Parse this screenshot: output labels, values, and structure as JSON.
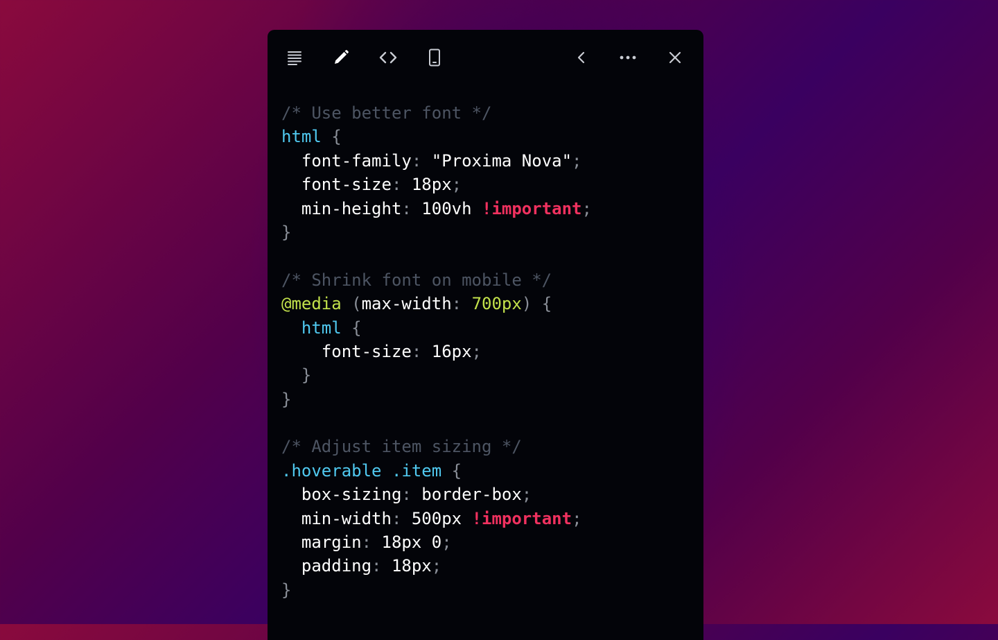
{
  "toolbar": {
    "left_icons": [
      "text-align-icon",
      "pencil-icon",
      "code-icon",
      "mobile-device-icon"
    ],
    "right_icons": [
      "chevron-left-icon",
      "more-horizontal-icon",
      "close-icon"
    ]
  },
  "colors": {
    "panel_bg": "#030409",
    "comment": "#4d5563",
    "selector": "#50c9f0",
    "at_rule": "#c2e14b",
    "important": "#f0315f",
    "punctuation": "#8a8f98",
    "text": "#ffffff"
  },
  "code": {
    "lines": [
      [
        {
          "t": "comment",
          "v": "/* Use better font */"
        }
      ],
      [
        {
          "t": "sel",
          "v": "html"
        },
        {
          "t": "punct",
          "v": " {"
        }
      ],
      [
        {
          "t": "prop",
          "v": "  font-family"
        },
        {
          "t": "punct",
          "v": ": "
        },
        {
          "t": "val",
          "v": "\"Proxima Nova\""
        },
        {
          "t": "punct",
          "v": ";"
        }
      ],
      [
        {
          "t": "prop",
          "v": "  font-size"
        },
        {
          "t": "punct",
          "v": ": "
        },
        {
          "t": "val",
          "v": "18px"
        },
        {
          "t": "punct",
          "v": ";"
        }
      ],
      [
        {
          "t": "prop",
          "v": "  min-height"
        },
        {
          "t": "punct",
          "v": ": "
        },
        {
          "t": "val",
          "v": "100vh "
        },
        {
          "t": "imp",
          "v": "!important"
        },
        {
          "t": "punct",
          "v": ";"
        }
      ],
      [
        {
          "t": "punct",
          "v": "}"
        }
      ],
      [],
      [
        {
          "t": "comment",
          "v": "/* Shrink font on mobile */"
        }
      ],
      [
        {
          "t": "at",
          "v": "@media"
        },
        {
          "t": "punct",
          "v": " ("
        },
        {
          "t": "prop",
          "v": "max-width"
        },
        {
          "t": "punct",
          "v": ": "
        },
        {
          "t": "num",
          "v": "700px"
        },
        {
          "t": "punct",
          "v": ") {"
        }
      ],
      [
        {
          "t": "sel",
          "v": "  html"
        },
        {
          "t": "punct",
          "v": " {"
        }
      ],
      [
        {
          "t": "prop",
          "v": "    font-size"
        },
        {
          "t": "punct",
          "v": ": "
        },
        {
          "t": "val",
          "v": "16px"
        },
        {
          "t": "punct",
          "v": ";"
        }
      ],
      [
        {
          "t": "punct",
          "v": "  }"
        }
      ],
      [
        {
          "t": "punct",
          "v": "}"
        }
      ],
      [],
      [
        {
          "t": "comment",
          "v": "/* Adjust item sizing */"
        }
      ],
      [
        {
          "t": "sel",
          "v": ".hoverable .item"
        },
        {
          "t": "punct",
          "v": " {"
        }
      ],
      [
        {
          "t": "prop",
          "v": "  box-sizing"
        },
        {
          "t": "punct",
          "v": ": "
        },
        {
          "t": "val",
          "v": "border-box"
        },
        {
          "t": "punct",
          "v": ";"
        }
      ],
      [
        {
          "t": "prop",
          "v": "  min-width"
        },
        {
          "t": "punct",
          "v": ": "
        },
        {
          "t": "val",
          "v": "500px "
        },
        {
          "t": "imp",
          "v": "!important"
        },
        {
          "t": "punct",
          "v": ";"
        }
      ],
      [
        {
          "t": "prop",
          "v": "  margin"
        },
        {
          "t": "punct",
          "v": ": "
        },
        {
          "t": "val",
          "v": "18px 0"
        },
        {
          "t": "punct",
          "v": ";"
        }
      ],
      [
        {
          "t": "prop",
          "v": "  padding"
        },
        {
          "t": "punct",
          "v": ": "
        },
        {
          "t": "val",
          "v": "18px"
        },
        {
          "t": "punct",
          "v": ";"
        }
      ],
      [
        {
          "t": "punct",
          "v": "}"
        }
      ]
    ]
  }
}
